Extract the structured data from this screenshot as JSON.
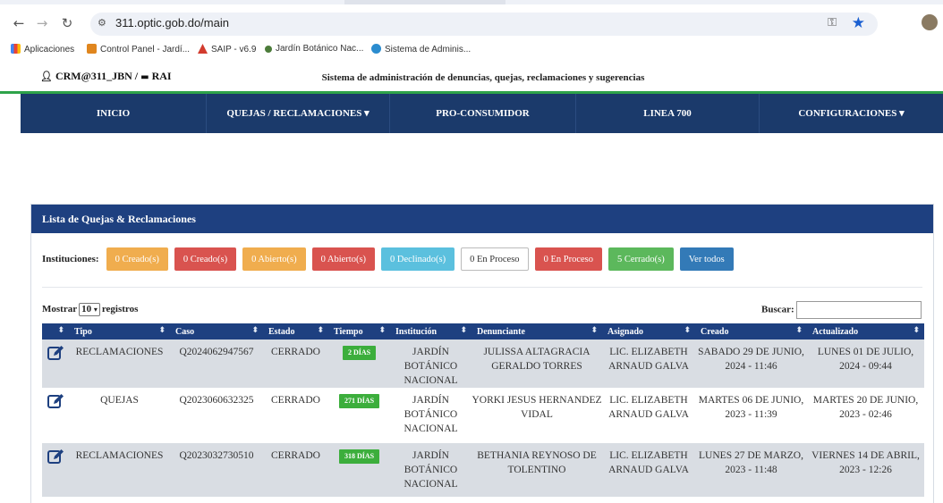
{
  "browser": {
    "url": "311.optic.gob.do/main",
    "bookmarks": [
      "Aplicaciones",
      "Control Panel - Jardí...",
      "SAIP - v6.9",
      "Jardín Botánico Nac...",
      "Sistema de Adminis..."
    ]
  },
  "header": {
    "brand": "CRM@311_JBN / ",
    "brand_suffix": "RAI",
    "title": "Sistema de administración de denuncias, quejas, reclamaciones y sugerencias"
  },
  "nav": {
    "items": [
      "INICIO",
      "QUEJAS / RECLAMACIONES ▾",
      "PRO-CONSUMIDOR",
      "LINEA 700",
      "CONFIGURACIONES ▾"
    ]
  },
  "panel": {
    "title": "Lista de Quejas & Reclamaciones",
    "filters_label": "Instituciones:",
    "filters": [
      {
        "label": "0 Creado(s)",
        "color": "#f0ad4e"
      },
      {
        "label": "0 Creado(s)",
        "color": "#d9534f"
      },
      {
        "label": "0 Abierto(s)",
        "color": "#f0ad4e"
      },
      {
        "label": "0 Abierto(s)",
        "color": "#d9534f"
      },
      {
        "label": "0 Declinado(s)",
        "color": "#5bc0de"
      },
      {
        "label": "0 En Proceso",
        "color": "#ffffff"
      },
      {
        "label": "0 En Proceso",
        "color": "#d9534f"
      },
      {
        "label": "5 Cerrado(s)",
        "color": "#5cb85c"
      },
      {
        "label": "Ver todos",
        "color": "#337ab7"
      }
    ],
    "length": {
      "prefix": "Mostrar",
      "value": "10",
      "suffix": "registros"
    },
    "search_label": "Buscar:"
  },
  "table": {
    "headers": [
      "",
      "Tipo",
      "Caso",
      "Estado",
      "Tiempo",
      "Institución",
      "Denunciante",
      "Asignado",
      "Creado",
      "Actualizado"
    ],
    "rows": [
      {
        "tipo": "RECLAMACIONES",
        "caso": "Q2024062947567",
        "estado": "CERRADO",
        "tiempo": "2 DÍAS",
        "institucion": "JARDÍN BOTÁNICO NACIONAL",
        "denunciante": "JULISSA ALTAGRACIA GERALDO TORRES",
        "asignado": "LIC. ELIZABETH ARNAUD GALVA",
        "creado": "SABADO 29 DE JUNIO, 2024 - 11:46",
        "actualizado": "LUNES 01 DE JULIO, 2024 - 09:44"
      },
      {
        "tipo": "QUEJAS",
        "caso": "Q2023060632325",
        "estado": "CERRADO",
        "tiempo": "271 DÍAS",
        "institucion": "JARDÍN BOTÁNICO NACIONAL",
        "denunciante": "YORKI JESUS HERNANDEZ VIDAL",
        "asignado": "LIC. ELIZABETH ARNAUD GALVA",
        "creado": "MARTES 06 DE JUNIO, 2023 - 11:39",
        "actualizado": "MARTES 20 DE JUNIO, 2023 - 02:46"
      },
      {
        "tipo": "RECLAMACIONES",
        "caso": "Q2023032730510",
        "estado": "CERRADO",
        "tiempo": "318 DÍAS",
        "institucion": "JARDÍN BOTÁNICO NACIONAL",
        "denunciante": "BETHANIA REYNOSO DE TOLENTINO",
        "asignado": "LIC. ELIZABETH ARNAUD GALVA",
        "creado": "LUNES 27 DE MARZO, 2023 - 11:48",
        "actualizado": "VIERNES 14 DE ABRIL, 2023 - 12:26"
      }
    ]
  }
}
